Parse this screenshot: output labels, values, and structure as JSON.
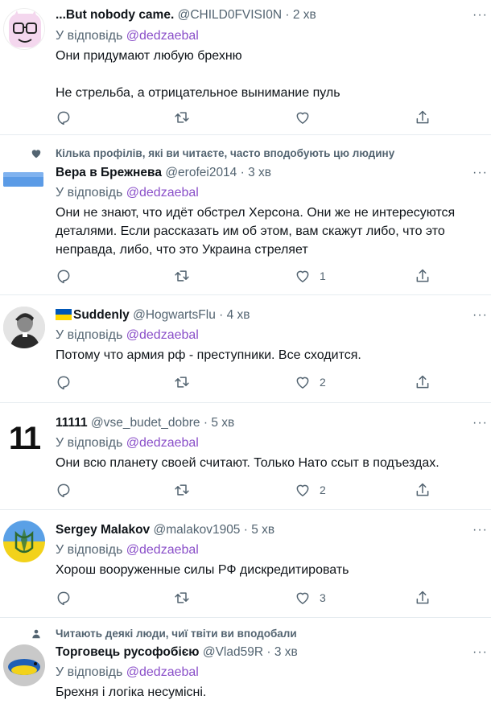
{
  "reply_prefix": "У відповідь",
  "tweets": [
    {
      "name": "...But nobody came.",
      "handle": "@CHILD0FVISI0N",
      "time": "2 хв",
      "reply_to": "@dedzaebal",
      "text": [
        "Они придумают любую брехню",
        "Не стрельба, а отрицательное вынимание пуль"
      ],
      "likes": ""
    },
    {
      "social_context": "Кілька профілів, які ви читаєте, часто вподобують цю людину",
      "name": "Вера в Брежнева",
      "handle": "@erofei2014",
      "time": "3 хв",
      "reply_to": "@dedzaebal",
      "text": [
        "Они не знают, что идёт обстрел Херсона. Они же не интересуются деталями. Если рассказать им об этом, вам скажут либо, что это неправда, либо, что это Украина стреляет"
      ],
      "likes": "1"
    },
    {
      "name": "Suddenly",
      "handle": "@HogwartsFlu",
      "time": "4 хв",
      "reply_to": "@dedzaebal",
      "text": [
        "Потому что армия рф - преступники. Все сходится."
      ],
      "likes": "2"
    },
    {
      "name": "11111",
      "handle": "@vse_budet_dobre",
      "time": "5 хв",
      "reply_to": "@dedzaebal",
      "text": [
        "Они всю планету своей считают. Только Нато ссыт в подъездах."
      ],
      "likes": "2"
    },
    {
      "name": "Sergey Malakov",
      "handle": "@malakov1905",
      "time": "5 хв",
      "reply_to": "@dedzaebal",
      "text": [
        "Хорош вооруженные силы РФ дискредитировать"
      ],
      "likes": "3"
    },
    {
      "social_context": "Читають деякі люди, чиї твіти ви вподобали",
      "name": "Торговець русофобією",
      "handle": "@Vlad59R",
      "time": "3 хв",
      "reply_to": "@dedzaebal",
      "text": [
        "Брехня і логіка несумісні."
      ],
      "likes": ""
    }
  ],
  "avatar_11_text": "11",
  "colors": {
    "accent_handle": "#8a4fc9",
    "muted": "#536471",
    "divider": "#e6ecf0",
    "ua_blue": "#0057b7",
    "ua_yellow": "#ffd700"
  },
  "icons": [
    "reply-icon",
    "retweet-icon",
    "like-icon",
    "share-icon",
    "heart-icon",
    "person-icon",
    "more-icon"
  ]
}
